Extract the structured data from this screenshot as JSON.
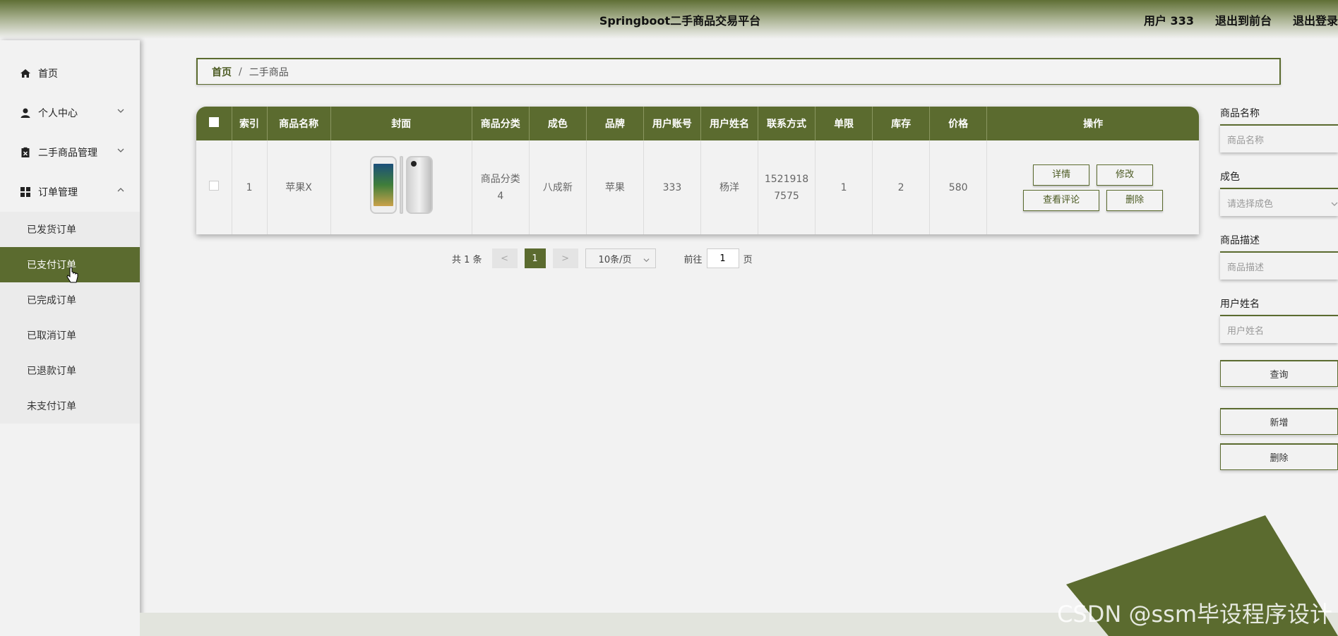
{
  "header": {
    "title": "Springboot二手商品交易平台",
    "user": "用户 333",
    "back_front": "退出到前台",
    "logout": "退出登录"
  },
  "sidebar": {
    "items": [
      {
        "label": "首页",
        "icon": "home-icon"
      },
      {
        "label": "个人中心",
        "icon": "user-icon"
      },
      {
        "label": "二手商品管理",
        "icon": "clipboard-icon"
      },
      {
        "label": "订单管理",
        "icon": "grid-icon"
      }
    ],
    "orders_sub": [
      "已发货订单",
      "已支付订单",
      "已完成订单",
      "已取消订单",
      "已退款订单",
      "未支付订单"
    ]
  },
  "breadcrumb": {
    "home": "首页",
    "separator": "/",
    "current": "二手商品"
  },
  "table": {
    "headers": [
      "索引",
      "商品名称",
      "封面",
      "商品分类",
      "成色",
      "品牌",
      "用户账号",
      "用户姓名",
      "联系方式",
      "单限",
      "库存",
      "价格",
      "操作"
    ],
    "row": {
      "index": "1",
      "name": "苹果X",
      "category_line1": "商品分类",
      "category_line2": "4",
      "condition": "八成新",
      "brand": "苹果",
      "account": "333",
      "username": "杨洋",
      "phone_line1": "1521918",
      "phone_line2": "7575",
      "limit": "1",
      "stock": "2",
      "price": "580"
    },
    "ops": {
      "detail": "详情",
      "edit": "修改",
      "comments": "查看评论",
      "delete": "删除"
    }
  },
  "pager": {
    "total": "共 1 条",
    "prev": "<",
    "page": "1",
    "next": ">",
    "size": "10条/页",
    "goto": "前往",
    "goto_value": "1",
    "page_unit": "页"
  },
  "search": {
    "name_label": "商品名称",
    "name_placeholder": "商品名称",
    "condition_label": "成色",
    "condition_placeholder": "请选择成色",
    "desc_label": "商品描述",
    "desc_placeholder": "商品描述",
    "user_label": "用户姓名",
    "user_placeholder": "用户姓名",
    "query": "查询",
    "add": "新增",
    "delete": "删除"
  },
  "watermark": "CSDN @ssm毕设程序设计",
  "colors": {
    "accent": "#5b6b2f"
  }
}
